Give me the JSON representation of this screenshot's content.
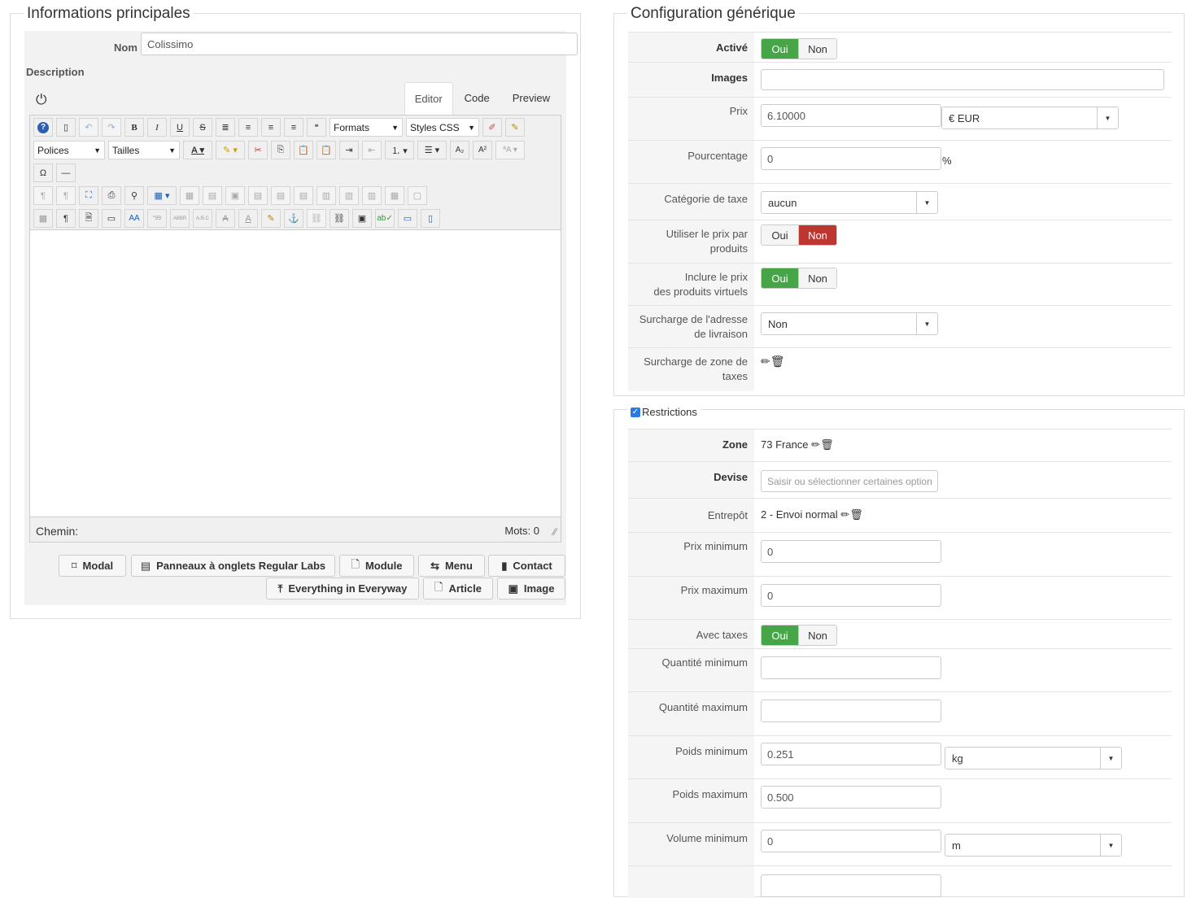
{
  "left": {
    "legend": "Informations principales",
    "name_label": "Nom",
    "name_value": "Colissimo",
    "description_label": "Description",
    "tabs": [
      "Editor",
      "Code",
      "Preview"
    ],
    "formats": "Formats",
    "styles": "Styles CSS",
    "fonts": "Polices",
    "sizes": "Tailles",
    "path_label": "Chemin:",
    "words_label": "Mots: 0",
    "buttons": {
      "modal": "Modal",
      "tabs_panels": "Panneaux à onglets Regular Labs",
      "module": "Module",
      "menu": "Menu",
      "contact": "Contact",
      "everything": "Everything in Everyway",
      "article": "Article",
      "image": "Image"
    }
  },
  "config": {
    "legend": "Configuration générique",
    "active_label": "Activé",
    "images_label": "Images",
    "price_label": "Prix",
    "price_value": "6.10000",
    "currency": "€ EUR",
    "percent_label": "Pourcentage",
    "percent_value": "0",
    "percent_unit": "%",
    "tax_label": "Catégorie de taxe",
    "tax_value": "aucun",
    "per_product_label_1": "Utiliser le prix par",
    "per_product_label_2": "produits",
    "virtual_label_1": "Inclure le prix",
    "virtual_label_2": "des produits virtuels",
    "override_addr_label_1": "Surcharge de l'adresse",
    "override_addr_label_2": "de livraison",
    "override_addr_value": "Non",
    "override_zone_label_1": "Surcharge de zone de",
    "override_zone_label_2": "taxes",
    "yes": "Oui",
    "no": "Non"
  },
  "restrictions": {
    "legend": "Restrictions",
    "zone_label": "Zone",
    "zone_value": "73 France",
    "currency_label": "Devise",
    "currency_placeholder": "Saisir ou sélectionner certaines options",
    "warehouse_label": "Entrepôt",
    "warehouse_value": "2 - Envoi normal",
    "min_price_label": "Prix minimum",
    "min_price_value": "0",
    "max_price_label": "Prix maximum",
    "max_price_value": "0",
    "with_tax_label": "Avec taxes",
    "min_qty_label": "Quantité minimum",
    "max_qty_label": "Quantité maximum",
    "min_weight_label": "Poids minimum",
    "min_weight_value": "0.251",
    "weight_unit": "kg",
    "max_weight_label": "Poids maximum",
    "max_weight_value": "0.500",
    "min_volume_label": "Volume minimum",
    "min_volume_value": "0",
    "volume_unit": "m",
    "yes": "Oui",
    "no": "Non"
  }
}
